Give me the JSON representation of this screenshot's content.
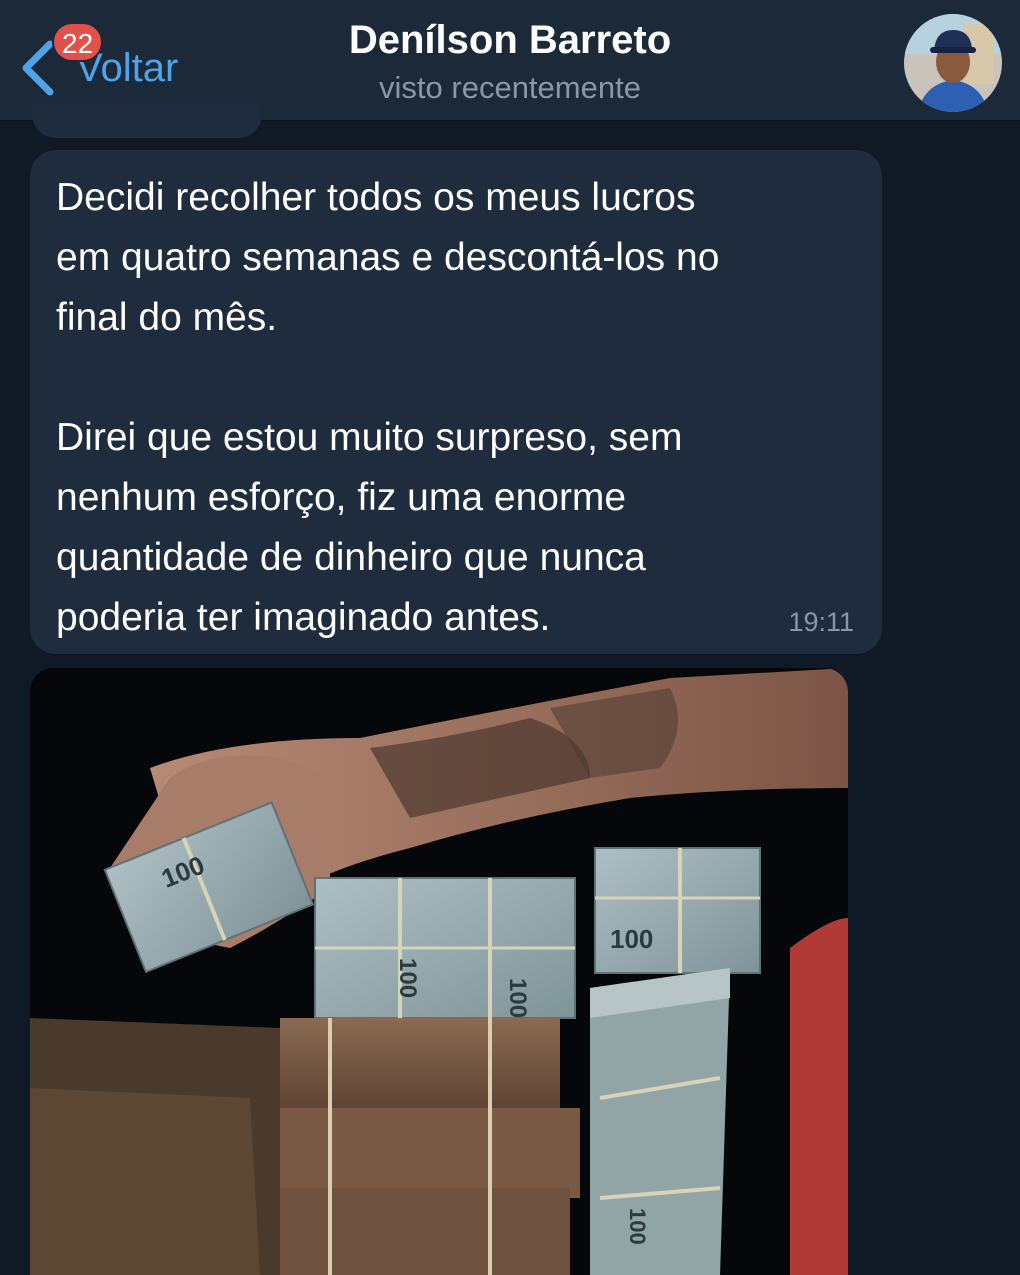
{
  "header": {
    "back_label": "Voltar",
    "unread_badge": "22",
    "contact_name": "Denílson Barreto",
    "status": "visto recentemente",
    "accent_color": "#4fa3e8",
    "badge_color": "#e2504c",
    "back_icon": "chevron-left-icon"
  },
  "message": {
    "text": "Decidi recolher todos os meus lucros\nem quatro semanas e descontá-los no\nfinal do mês.\n\nDirei que estou muito surpreso, sem\nnenhum esforço, fiz uma enorme\nquantidade de dinheiro que nunca\npoderia ter imaginado antes.",
    "time": "19:11",
    "bubble_color": "#1e2c3d"
  },
  "photo_note_labels": [
    "100",
    "100",
    "100",
    "100",
    "100"
  ]
}
